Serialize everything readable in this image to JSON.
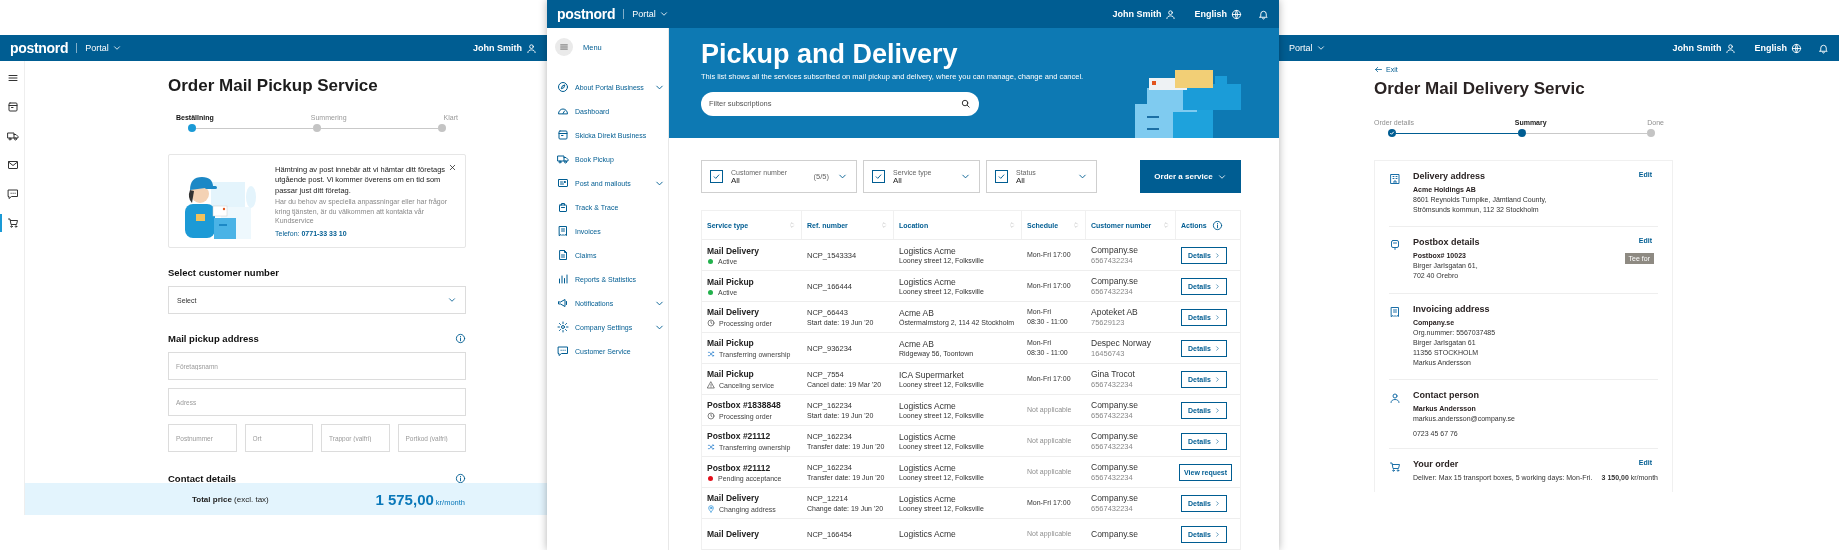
{
  "left_screen": {
    "header": {
      "logo": "postnord",
      "menu": "Portal",
      "user": "John Smith"
    },
    "rail": [
      {
        "selected": false
      },
      {
        "selected": false
      },
      {
        "selected": false
      },
      {
        "selected": false
      },
      {
        "selected": true
      }
    ],
    "title": "Order Mail Pickup Service",
    "steps": [
      {
        "label": "Beställning",
        "completed": false,
        "selected": true
      },
      {
        "label": "Summering",
        "completed": false,
        "selected": false
      },
      {
        "label": "Klart",
        "completed": false,
        "selected": false
      }
    ],
    "info_card": {
      "text": "Hämtning av post innebär att vi hämtar ditt företags utgående post. Vi kommer överens om en tid som passar just ditt företag.",
      "subtext": "Har du behov av speciella anpassningar eller har frågor kring tjänsten, är du välkommen att kontakta vår Kundservice",
      "phone": "Telefon: **0771-33 33 10**"
    },
    "customer_section": {
      "title": "Select customer number",
      "select": "Select"
    },
    "address_section": {
      "title": "Mail pickup address",
      "fields": [
        {
          "placeholder": "Företagsnamn"
        },
        {
          "placeholder": "Adress"
        }
      ],
      "small_fields": [
        {
          "placeholder": "Postnummer"
        },
        {
          "placeholder": "Ort"
        },
        {
          "placeholder": "Trappor (valfri)"
        },
        {
          "placeholder": "Portkod (valfri)"
        }
      ]
    },
    "contact_section": {
      "title": "Contact details"
    },
    "total": {
      "label": "**Total price** (excl. tax)",
      "amount": "1 575,00",
      "unit": "kr/month"
    }
  },
  "middle_screen": {
    "header": {
      "logo": "postnord",
      "menu": "Portal",
      "user": "John Smith",
      "language": "English"
    },
    "sidebar": {
      "menu_label": "Menu",
      "items": [
        {
          "label": "About Portal Business",
          "expandable": true
        },
        {
          "label": "Dashboard",
          "expandable": false
        },
        {
          "label": "Skicka Direkt Business",
          "expandable": false
        },
        {
          "label": "Book Pickup",
          "expandable": false
        },
        {
          "label": "Post and mailouts",
          "expandable": true
        },
        {
          "label": "Track & Trace",
          "expandable": false
        },
        {
          "label": "Invoices",
          "expandable": false
        },
        {
          "label": "Claims",
          "expandable": false
        },
        {
          "label": "Reports & Statistics",
          "expandable": false
        },
        {
          "label": "Notifications",
          "expandable": true
        },
        {
          "label": "Company Settings",
          "expandable": true
        },
        {
          "label": "Customer Service",
          "expandable": false
        }
      ]
    },
    "hero": {
      "title": "Pickup and Delivery",
      "subtitle": "This list shows all the services subscribed on mail pickup and delivery, where you can manage, change and cancel.",
      "search_placeholder": "Filter subscriptions"
    },
    "filters": [
      {
        "label": "Customer number",
        "value": "All",
        "count": "(5/5)",
        "checked": true
      },
      {
        "label": "Service type",
        "value": "All",
        "checked": true
      },
      {
        "label": "Status",
        "value": "All",
        "checked": true
      }
    ],
    "order_button": "Order a service",
    "table": {
      "columns": [
        {
          "label": "Service type",
          "kind": "sort"
        },
        {
          "label": "Ref. number",
          "kind": "sort"
        },
        {
          "label": "Location",
          "kind": "sort"
        },
        {
          "label": "Schedule",
          "kind": "sort"
        },
        {
          "label": "Customer number",
          "kind": "sort"
        },
        {
          "label": "Actions",
          "kind": "info"
        }
      ],
      "rows": [
        {
          "service": "Mail Delivery",
          "status": {
            "label": "Active",
            "kind": "dot",
            "color": "#22b14c"
          },
          "ref": "NCP_1543334",
          "location": "Logistics Acme",
          "address": "Looney street 12, Folksville",
          "schedule": [
            "Mon-Fri 17:00"
          ],
          "schedule_muted": false,
          "customer": "Company.se",
          "customer_number": "6567432234",
          "action": {
            "label": "Details",
            "kind": "details"
          }
        },
        {
          "service": "Mail Pickup",
          "status": {
            "label": "Active",
            "kind": "dot",
            "color": "#22b14c"
          },
          "ref": "NCP_166444",
          "location": "Logistics Acme",
          "address": "Looney street 12, Folksville",
          "schedule": [
            "Mon-Fri 17:00"
          ],
          "schedule_muted": false,
          "customer": "Company.se",
          "customer_number": "6567432234",
          "action": {
            "label": "Details",
            "kind": "details"
          }
        },
        {
          "service": "Mail Delivery",
          "status": {
            "label": "Processing order",
            "kind": "clock"
          },
          "ref": "NCP_66443",
          "ref_note": "Start date: 19 Jun '20",
          "location": "Acme AB",
          "address": "Östermalmstorg 2, 114 42 Stockholm",
          "schedule": [
            "Mon-Fri",
            "08:30 - 11:00"
          ],
          "schedule_muted": false,
          "customer": "Apoteket AB",
          "customer_number": "75629123",
          "action": {
            "label": "Details",
            "kind": "details"
          }
        },
        {
          "service": "Mail Pickup",
          "status": {
            "label": "Transferring ownership",
            "kind": "shuffle"
          },
          "ref": "NCP_936234",
          "location": "Acme AB",
          "address": "Ridgeway 56, Toontown",
          "schedule": [
            "Mon-Fri",
            "08:30 - 11:00"
          ],
          "schedule_muted": false,
          "customer": "Despec Norway",
          "customer_number": "16456743",
          "action": {
            "label": "Details",
            "kind": "details"
          }
        },
        {
          "service": "Mail Pickup",
          "status": {
            "label": "Canceling service",
            "kind": "warning"
          },
          "ref": "NCP_7554",
          "ref_note": "Cancel date: 19 Mar '20",
          "location": "ICA Supermarket",
          "address": "Looney street 12, Folksville",
          "schedule": [
            "Mon-Fri 17:00"
          ],
          "schedule_muted": false,
          "customer": "Gina Trocot",
          "customer_number": "6567432234",
          "action": {
            "label": "Details",
            "kind": "details"
          }
        },
        {
          "service": "Postbox #1838848",
          "status": {
            "label": "Processing order",
            "kind": "clock"
          },
          "ref": "NCP_162234",
          "ref_note": "Start date: 19 Jun '20",
          "location": "Logistics Acme",
          "address": "Looney street 12, Folksville",
          "schedule": [
            "Not applicable"
          ],
          "schedule_muted": true,
          "customer": "Company.se",
          "customer_number": "6567432234",
          "action": {
            "label": "Details",
            "kind": "details"
          }
        },
        {
          "service": "Postbox #21112",
          "status": {
            "label": "Transferring ownership",
            "kind": "shuffle"
          },
          "ref": "NCP_162234",
          "ref_note": "Transfer date: 19 Jun '20",
          "location": "Logistics Acme",
          "address": "Looney street 12, Folksville",
          "schedule": [
            "Not applicable"
          ],
          "schedule_muted": true,
          "customer": "Company.se",
          "customer_number": "6567432234",
          "action": {
            "label": "Details",
            "kind": "details"
          }
        },
        {
          "service": "Postbox #21112",
          "status": {
            "label": "Pending acceptance",
            "kind": "dot",
            "color": "#e3101c"
          },
          "ref": "NCP_162234",
          "ref_note": "Transfer date: 19 Jun '20",
          "location": "Logistics Acme",
          "address": "Looney street 12, Folksville",
          "schedule": [
            "Not applicable"
          ],
          "schedule_muted": true,
          "customer": "Company.se",
          "customer_number": "6567432234",
          "action": {
            "label": "View request",
            "kind": "plain"
          }
        },
        {
          "service": "Mail Delivery",
          "status": {
            "label": "Changing address",
            "kind": "pin"
          },
          "ref": "NCP_12214",
          "ref_note": "Change date: 19 Jun '20",
          "location": "Logistics Acme",
          "address": "Looney street 12, Folksville",
          "schedule": [
            "Mon-Fri 17:00"
          ],
          "schedule_muted": false,
          "customer": "Company.se",
          "customer_number": "6567432234",
          "action": {
            "label": "Details",
            "kind": "details"
          }
        },
        {
          "service": "Mail Delivery",
          "ref": "NCP_166454",
          "location": "Logistics Acme",
          "schedule": [
            "Not applicable"
          ],
          "schedule_muted": true,
          "customer": "Company.se",
          "action": {
            "label": "Details",
            "kind": "details"
          }
        }
      ]
    }
  },
  "right_screen": {
    "header": {
      "menu": "Portal",
      "user": "John Smith",
      "language": "English"
    },
    "back": "Exit",
    "title": "Order Mail Delivery Servic",
    "steps": [
      {
        "label": "Order details",
        "completed": true,
        "selected": false
      },
      {
        "label": "Summary",
        "completed": false,
        "selected": true
      },
      {
        "label": "Done",
        "completed": false,
        "selected": false
      }
    ],
    "sections": [
      {
        "kind": "details",
        "title": "Delivery address",
        "edit": "Edit",
        "name": "Acme Holdings AB",
        "lines": [
          "8601 Reynolds Turnpike, Jämtland County,",
          "Strömsunds kommun, 112 32 Stockholm"
        ]
      },
      {
        "kind": "details",
        "title": "Postbox details",
        "edit": "Edit",
        "tag": "Tee for",
        "name": "Postbox# 10023",
        "lines": [
          "Birger Jarlsgatan 61,",
          "702 40 Orebro"
        ]
      },
      {
        "kind": "details",
        "title": "Invoicing address",
        "name": "Company.se",
        "lines": [
          "Org.nummer: 5567037485",
          "Birger Jarlsgatan 61",
          "11356 STOCKHOLM",
          "Markus Andersson"
        ]
      },
      {
        "kind": "details",
        "title": "Contact person",
        "name": "Markus Andersson",
        "lines": [
          "markus.andersson@company.se"
        ],
        "footer_line": "0723 45 67 76"
      },
      {
        "kind": "order",
        "title": "Your order",
        "edit": "Edit",
        "line": "Deliver: Max 15 transport boxes, 5 working days: Mon-Fri.",
        "price": "**3 150,00** kr/month"
      }
    ]
  }
}
